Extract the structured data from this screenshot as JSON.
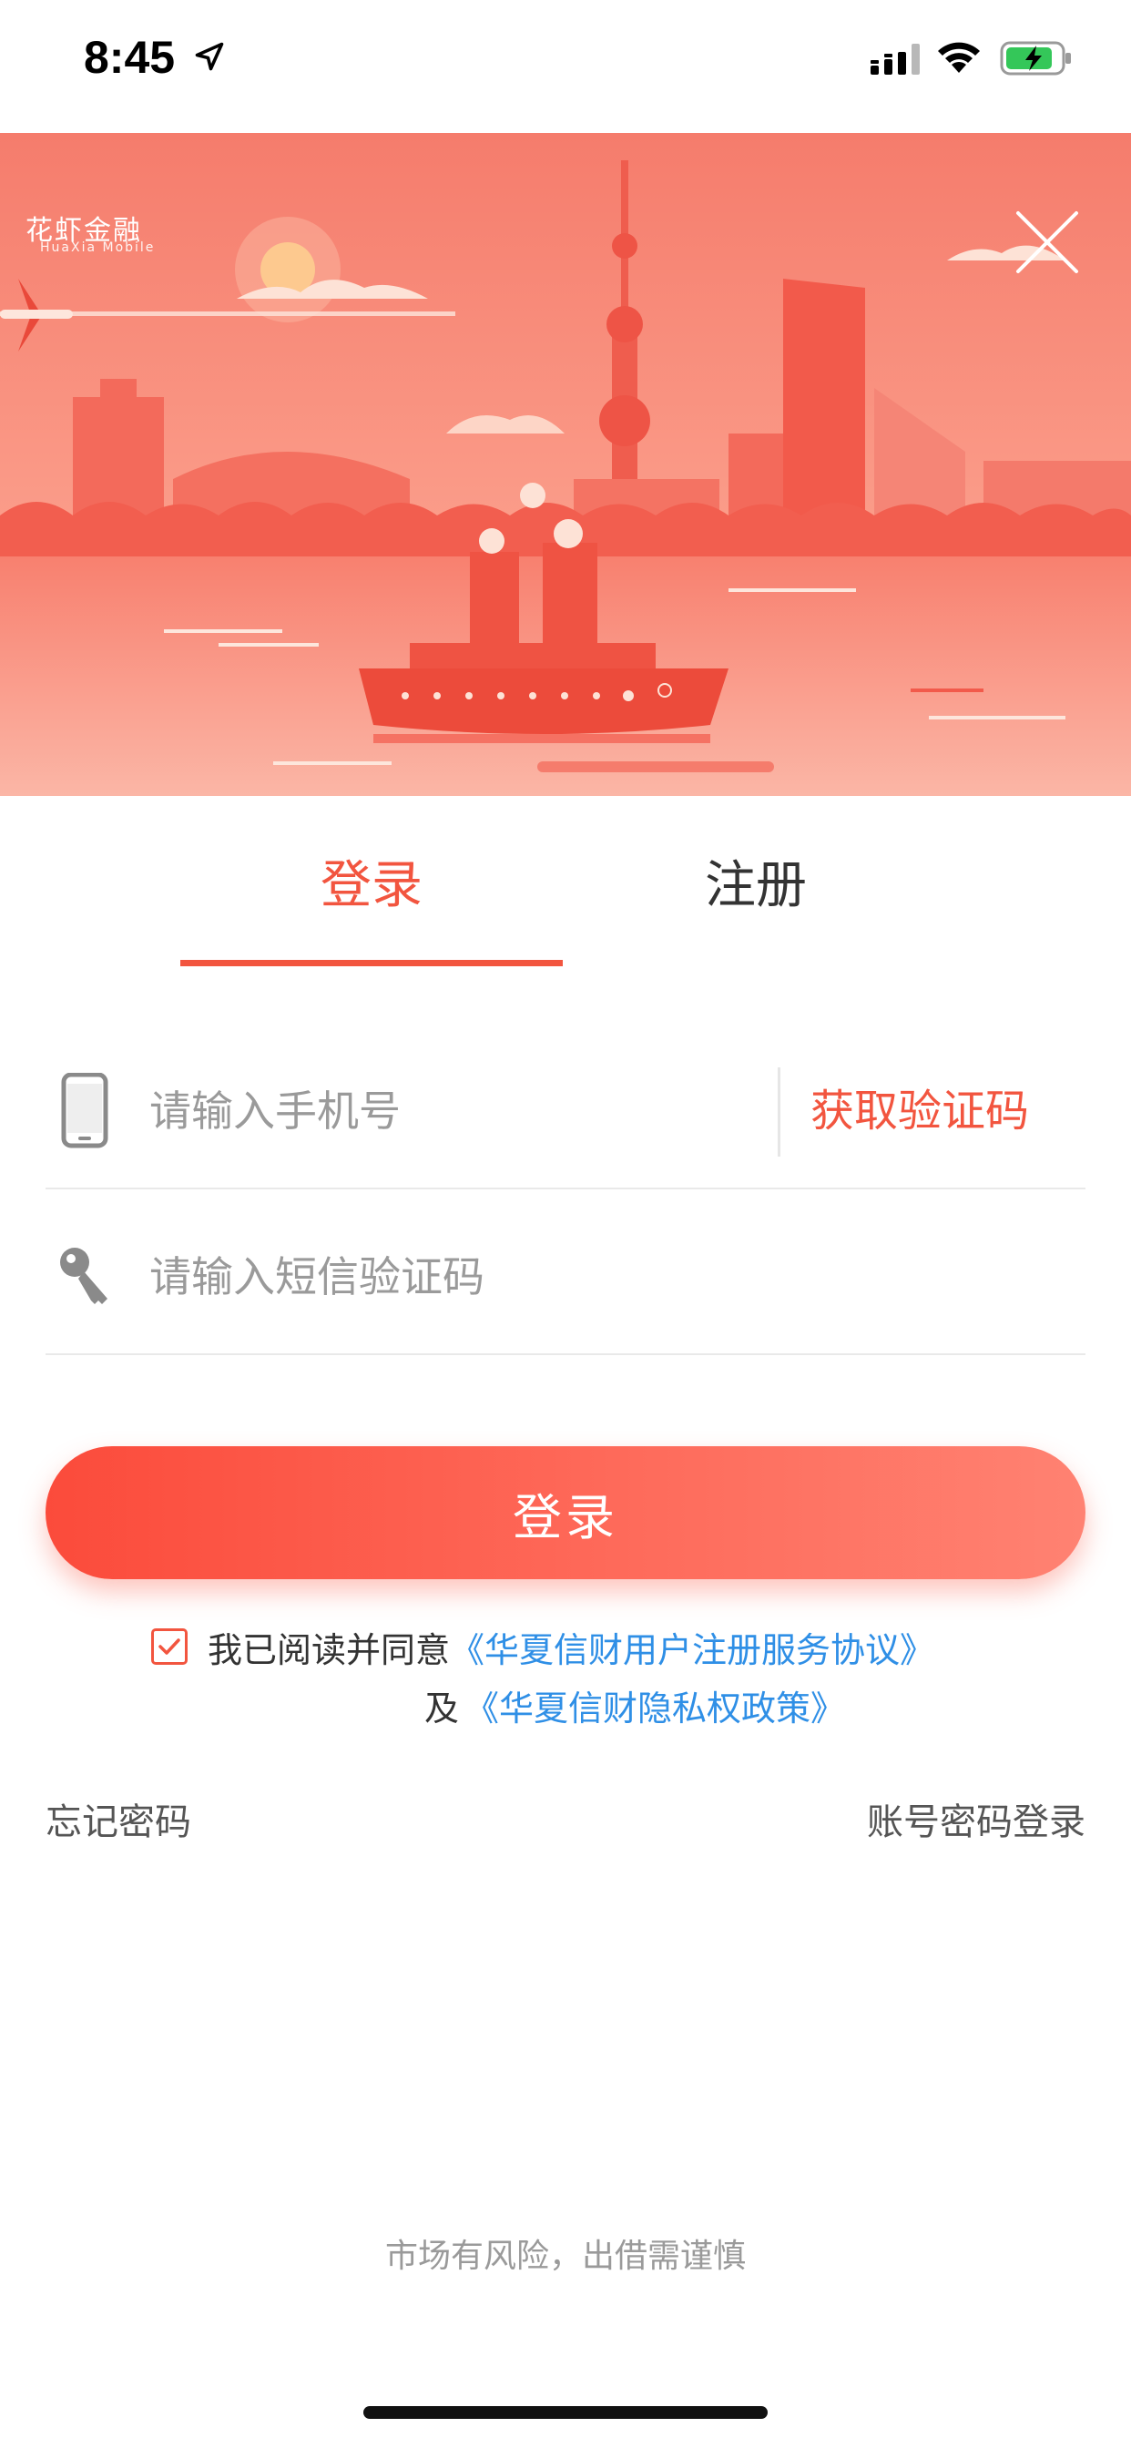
{
  "status_bar": {
    "time": "8:45"
  },
  "banner": {
    "logo_text": "花虾金融",
    "logo_subtext": "HuaXia Mobile",
    "close_icon": "close-icon"
  },
  "tabs": {
    "login_label": "登录",
    "register_label": "注册",
    "active": "login",
    "active_color": "#f2553f"
  },
  "form": {
    "phone_placeholder": "请输入手机号",
    "phone_value": "",
    "get_code_label": "获取验证码",
    "code_placeholder": "请输入短信验证码",
    "code_value": "",
    "phone_icon": "phone-icon",
    "key_icon": "key-icon"
  },
  "login_button": {
    "label": "登录"
  },
  "agreement": {
    "checked": true,
    "prefix": "我已阅读并同意",
    "terms_link": "《华夏信财用户注册服务协议》",
    "and": "及",
    "privacy_link": "《华夏信财隐私权政策》",
    "link_color": "#2f8fe6"
  },
  "links": {
    "forgot_password": "忘记密码",
    "account_login": "账号密码登录"
  },
  "footer": {
    "risk_notice": "市场有风险，出借需谨慎"
  }
}
